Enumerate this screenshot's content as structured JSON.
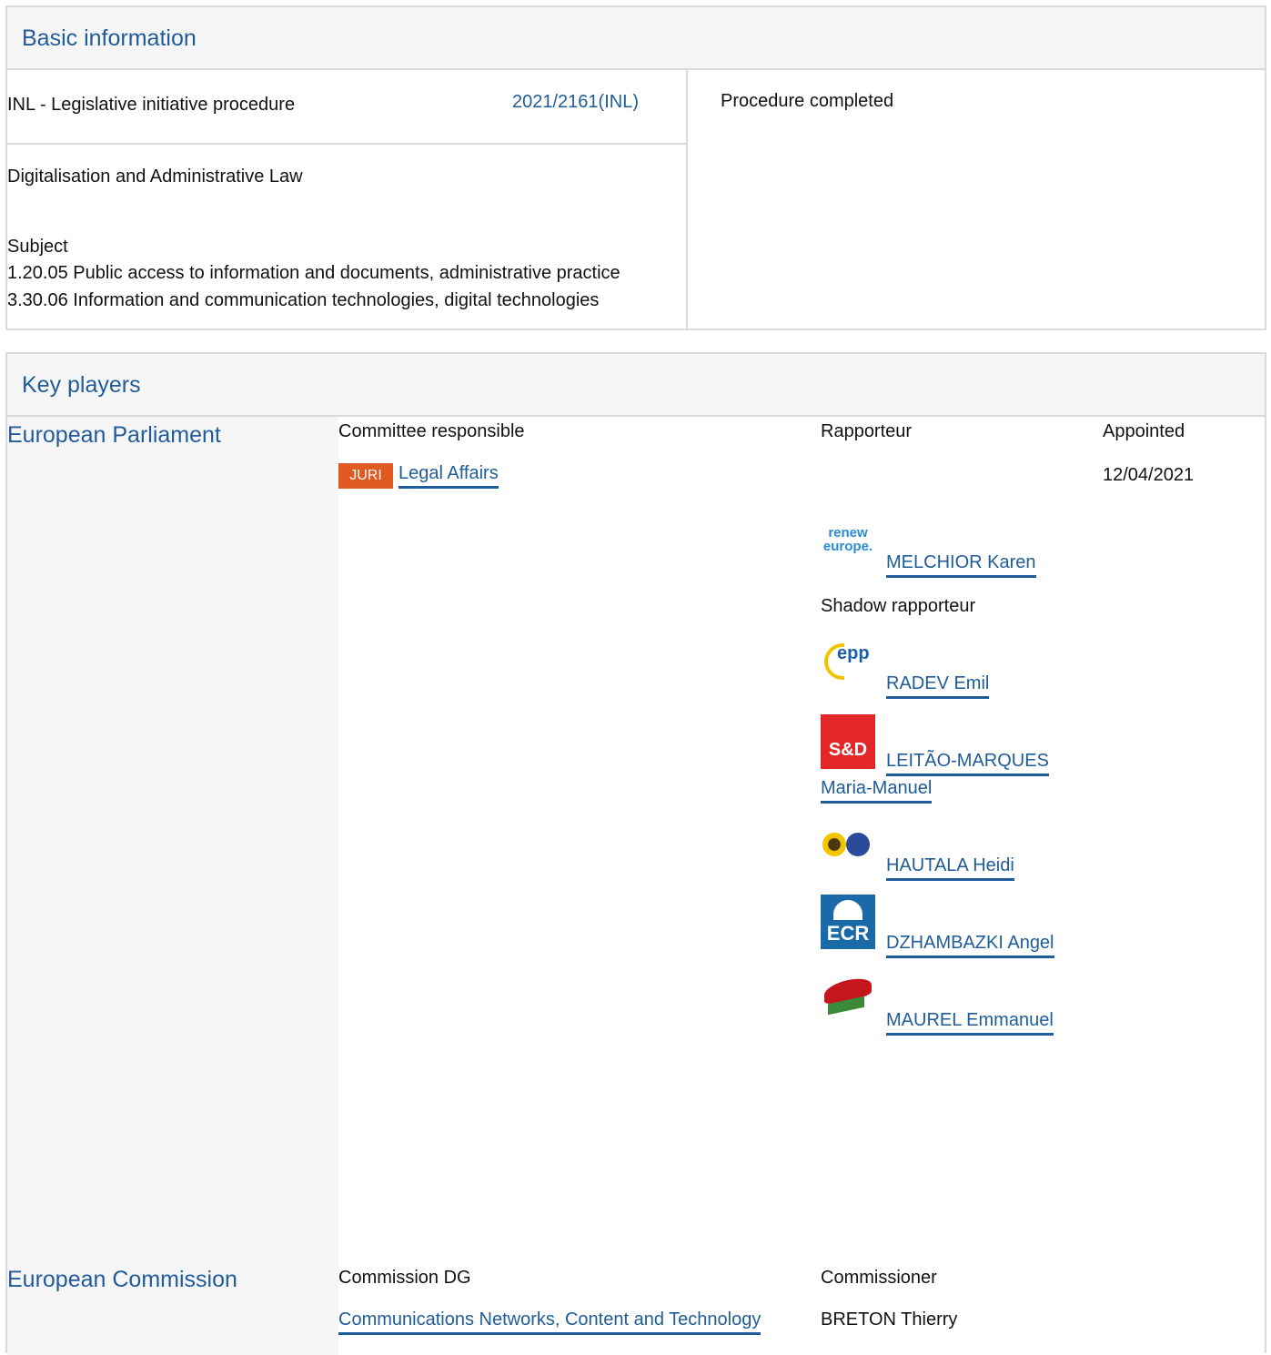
{
  "basic": {
    "title": "Basic information",
    "procedure_type": "INL - Legislative initiative procedure",
    "procedure_ref": "2021/2161(INL)",
    "status": "Procedure completed",
    "procedure_title": "Digitalisation and Administrative Law",
    "subject_label": "Subject",
    "subjects": [
      "1.20.05 Public access to information and documents, administrative practice",
      "3.30.06 Information and communication technologies, digital technologies"
    ]
  },
  "key_players": {
    "title": "Key players",
    "ep": {
      "institution": "European Parliament",
      "col_committee": "Committee responsible",
      "col_rapporteur": "Rapporteur",
      "col_appointed": "Appointed",
      "committee_badge": "JURI",
      "committee_name": "Legal Affairs",
      "appointed_date": "12/04/2021",
      "rapporteur": {
        "name": "MELCHIOR Karen",
        "logo_text_1": "renew",
        "logo_text_2": "europe."
      },
      "shadow_label": "Shadow rapporteur",
      "shadows": [
        {
          "name": "RADEV Emil",
          "logo": "epp-logo",
          "logo_text": "epp"
        },
        {
          "name_line1": "LEITÃO-MARQUES",
          "name_line2": "Maria-Manuel",
          "logo": "sd-logo",
          "logo_text": "S&D"
        },
        {
          "name": "HAUTALA Heidi",
          "logo": "greens-efa-logo"
        },
        {
          "name": "DZHAMBAZKI Angel",
          "logo": "ecr-logo",
          "logo_text": "ECR"
        },
        {
          "name": "MAUREL Emmanuel",
          "logo": "left-logo"
        }
      ]
    },
    "ec": {
      "institution": "European Commission",
      "col_dg": "Commission DG",
      "col_commissioner": "Commissioner",
      "dg_name": "Communications Networks, Content and Technology",
      "commissioner": "BRETON Thierry"
    }
  },
  "colors": {
    "link": "#1f5c99",
    "badge": "#e05a22",
    "panel_bg": "#f6f6f6",
    "border": "#dadada"
  }
}
